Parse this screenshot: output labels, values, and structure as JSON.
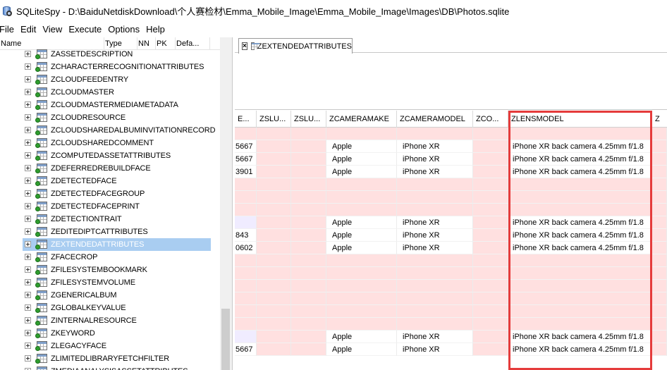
{
  "window": {
    "title": "SQLiteSpy - D:\\BaiduNetdiskDownload\\个人赛检材\\Emma_Mobile_Image\\Emma_Mobile_Image\\Images\\DB\\Photos.sqlite"
  },
  "menu": [
    "File",
    "Edit",
    "View",
    "Execute",
    "Options",
    "Help"
  ],
  "tree": {
    "columns": [
      "Name",
      "Type",
      "NN",
      "PK",
      "Defa..."
    ],
    "items": [
      "ZASSETDESCRIPTION",
      "ZCHARACTERRECOGNITIONATTRIBUTES",
      "ZCLOUDFEEDENTRY",
      "ZCLOUDMASTER",
      "ZCLOUDMASTERMEDIAMETADATA",
      "ZCLOUDRESOURCE",
      "ZCLOUDSHAREDALBUMINVITATIONRECORD",
      "ZCLOUDSHAREDCOMMENT",
      "ZCOMPUTEDASSETATTRIBUTES",
      "ZDEFERREDREBUILDFACE",
      "ZDETECTEDFACE",
      "ZDETECTEDFACEGROUP",
      "ZDETECTEDFACEPRINT",
      "ZDETECTIONTRAIT",
      "ZEDITEDIPTCATTRIBUTES",
      "ZEXTENDEDATTRIBUTES",
      "ZFACECROP",
      "ZFILESYSTEMBOOKMARK",
      "ZFILESYSTEMVOLUME",
      "ZGENERICALBUM",
      "ZGLOBALKEYVALUE",
      "ZINTERNALRESOURCE",
      "ZKEYWORD",
      "ZLEGACYFACE",
      "ZLIMITEDLIBRARYFETCHFILTER",
      "ZMEDIAANALYSISASSETATTRIBUTES"
    ],
    "selected_index": 15
  },
  "tab": {
    "label": "ZEXTENDEDATTRIBUTES"
  },
  "grid": {
    "columns": [
      "E...",
      "ZSLU...",
      "ZSLU...",
      "ZCAMERAMAKE",
      "ZCAMERAMODEL",
      "ZCO...",
      "ZLENSMODEL",
      "Z"
    ],
    "rows": [
      {
        "c0": "",
        "make": "",
        "model": "",
        "lens": "",
        "style": "null"
      },
      {
        "c0": "5667",
        "make": "Apple",
        "model": "iPhone XR",
        "lens": "iPhone XR back camera 4.25mm f/1.8",
        "style": "filled"
      },
      {
        "c0": "5667",
        "make": "Apple",
        "model": "iPhone XR",
        "lens": "iPhone XR back camera 4.25mm f/1.8",
        "style": "filled"
      },
      {
        "c0": "3901",
        "make": "Apple",
        "model": "iPhone XR",
        "lens": "iPhone XR back camera 4.25mm f/1.8",
        "style": "filled"
      },
      {
        "c0": "",
        "make": "",
        "model": "",
        "lens": "",
        "style": "null"
      },
      {
        "c0": "",
        "make": "",
        "model": "",
        "lens": "",
        "style": "null"
      },
      {
        "c0": "",
        "make": "",
        "model": "",
        "lens": "",
        "style": "null"
      },
      {
        "c0": "",
        "make": "Apple",
        "model": "iPhone XR",
        "lens": "iPhone XR back camera 4.25mm f/1.8",
        "style": "purple"
      },
      {
        "c0": "843",
        "make": "Apple",
        "model": "iPhone XR",
        "lens": "iPhone XR back camera 4.25mm f/1.8",
        "style": "filled"
      },
      {
        "c0": "0602",
        "make": "Apple",
        "model": "iPhone XR",
        "lens": "iPhone XR back camera 4.25mm f/1.8",
        "style": "filled"
      },
      {
        "c0": "",
        "make": "",
        "model": "",
        "lens": "",
        "style": "null"
      },
      {
        "c0": "",
        "make": "",
        "model": "",
        "lens": "",
        "style": "null"
      },
      {
        "c0": "",
        "make": "",
        "model": "",
        "lens": "",
        "style": "null"
      },
      {
        "c0": "",
        "make": "",
        "model": "",
        "lens": "",
        "style": "null"
      },
      {
        "c0": "",
        "make": "",
        "model": "",
        "lens": "",
        "style": "null"
      },
      {
        "c0": "",
        "make": "",
        "model": "",
        "lens": "",
        "style": "null"
      },
      {
        "c0": "",
        "make": "Apple",
        "model": "iPhone XR",
        "lens": "iPhone XR back camera 4.25mm f/1.8",
        "style": "purple"
      },
      {
        "c0": "5667",
        "make": "Apple",
        "model": "iPhone XR",
        "lens": "iPhone XR back camera 4.25mm f/1.8",
        "style": "filled"
      }
    ]
  },
  "colors": {
    "null_cell": "#ffe0e0",
    "selection": "#a9cdf1",
    "highlight": "#e53b3b"
  }
}
